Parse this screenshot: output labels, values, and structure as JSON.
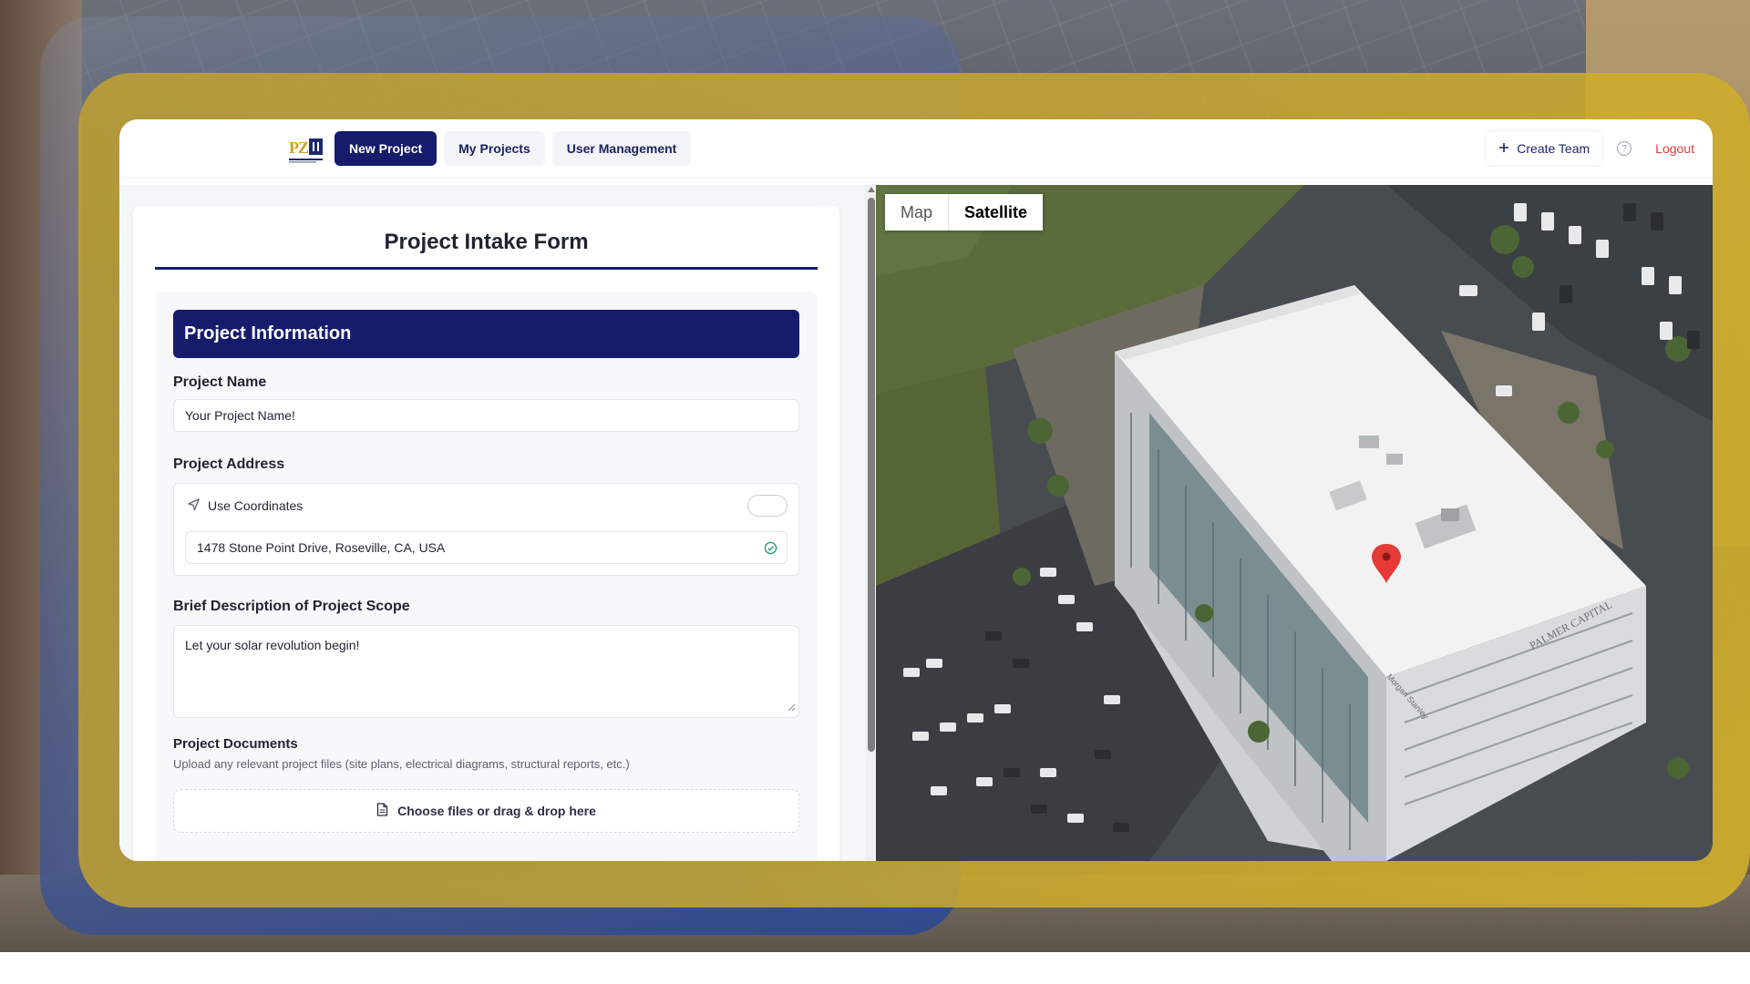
{
  "nav": {
    "items": [
      {
        "label": "New Project",
        "active": true
      },
      {
        "label": "My Projects",
        "active": false
      },
      {
        "label": "User Management",
        "active": false
      }
    ],
    "create_team": "Create Team",
    "logout": "Logout"
  },
  "form": {
    "title": "Project Intake Form",
    "section_title": "Project Information",
    "project_name_label": "Project Name",
    "project_name_value": "Your Project Name!",
    "address_label": "Project Address",
    "use_coordinates_label": "Use Coordinates",
    "use_coordinates_on": false,
    "address_value": "1478 Stone Point Drive, Roseville, CA, USA",
    "scope_label": "Brief Description of Project Scope",
    "scope_value": "Let your solar revolution begin!",
    "documents_label": "Project Documents",
    "documents_hint": "Upload any relevant project files (site plans, electrical diagrams, structural reports, etc.)",
    "dropzone_label": "Choose files or drag & drop here"
  },
  "map": {
    "tabs": [
      {
        "label": "Map",
        "active": false
      },
      {
        "label": "Satellite",
        "active": true
      }
    ],
    "building_sign": "PALMER CAPITAL",
    "building_sign_2": "Morgan Stanley"
  },
  "colors": {
    "primary": "#141c6b",
    "logout": "#e23b3b",
    "success": "#22a06b",
    "marker": "#e53935"
  }
}
